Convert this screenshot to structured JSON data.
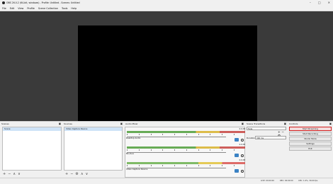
{
  "window": {
    "title": "OBS 26.0.2 (64-bit, windows) - Profile: Untitled - Scenes: Untitled",
    "controls": [
      "–",
      "□",
      "✕"
    ]
  },
  "menu": [
    "File",
    "Edit",
    "View",
    "Profile",
    "Scene Collection",
    "Tools",
    "Help"
  ],
  "docks": {
    "scenes": {
      "title": "Scenes",
      "items": [
        "Scene"
      ]
    },
    "sources": {
      "title": "Sources",
      "items": [
        "Video Capture Device"
      ]
    },
    "mixer": {
      "title": "Audio Mixer",
      "channels": [
        {
          "name": "Desktop Audio",
          "db": "0.0 dB"
        },
        {
          "name": "Mic/Aux",
          "db": "0.0 dB"
        },
        {
          "name": "Video Capture Device",
          "db": "0.0 dB"
        }
      ]
    },
    "transitions": {
      "title": "Scene Transitions",
      "transition": "Fade",
      "duration_label": "Duration",
      "duration_value": "300 ms"
    },
    "controls": {
      "title": "Controls",
      "buttons": [
        "Start Streaming",
        "Start Recording",
        "Studio Mode",
        "Settings",
        "Exit"
      ]
    }
  },
  "status": {
    "live": "LIVE: 00:00:00",
    "rec": "REC: 00:00:00",
    "cpu": "CPU: 1.0%, 30.00 fps"
  }
}
